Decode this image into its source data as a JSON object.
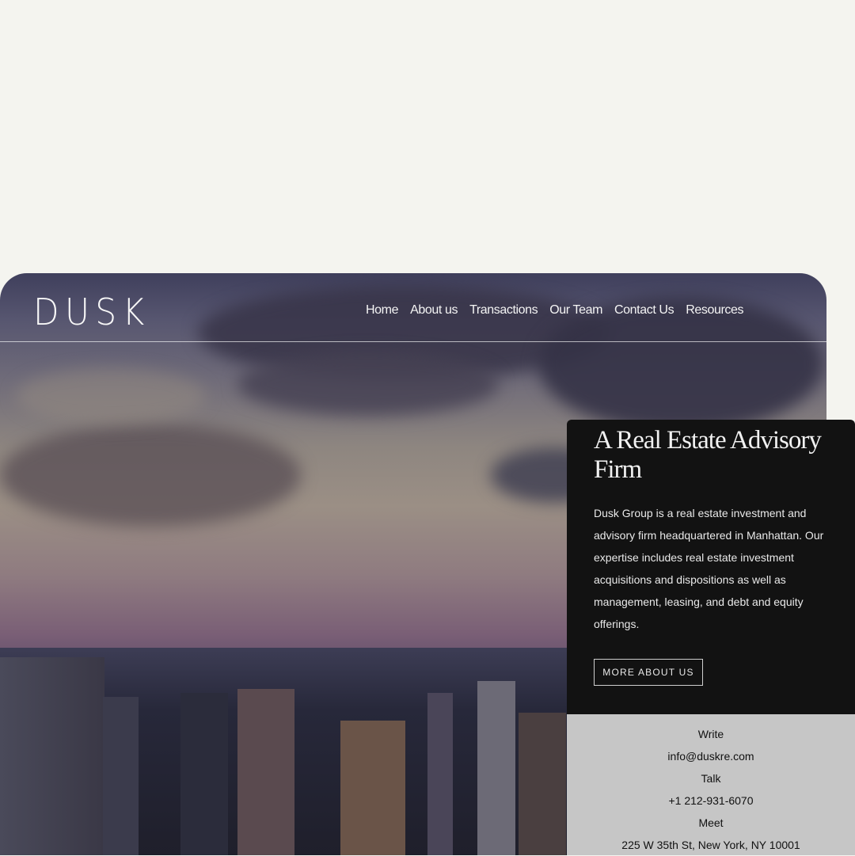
{
  "brand": {
    "logo": "DUSK"
  },
  "nav": {
    "items": [
      "Home",
      "About us",
      "Transactions",
      "Our Team",
      "Contact Us",
      "Resources"
    ]
  },
  "hero": {
    "title": "A Real Estate Advisory Firm",
    "description": "Dusk Group is a real estate investment and advisory firm headquartered in Manhattan. Our expertise includes real estate investment acquisitions and dispositions as well as management, leasing, and debt and equity offerings.",
    "button": "MORE ABOUT US"
  },
  "contact": {
    "write_label": "Write",
    "email": "info@duskre.com",
    "talk_label": "Talk",
    "phone": "+1 212-931-6070",
    "meet_label": "Meet",
    "address": "225 W 35th St, New York, NY 10001"
  }
}
